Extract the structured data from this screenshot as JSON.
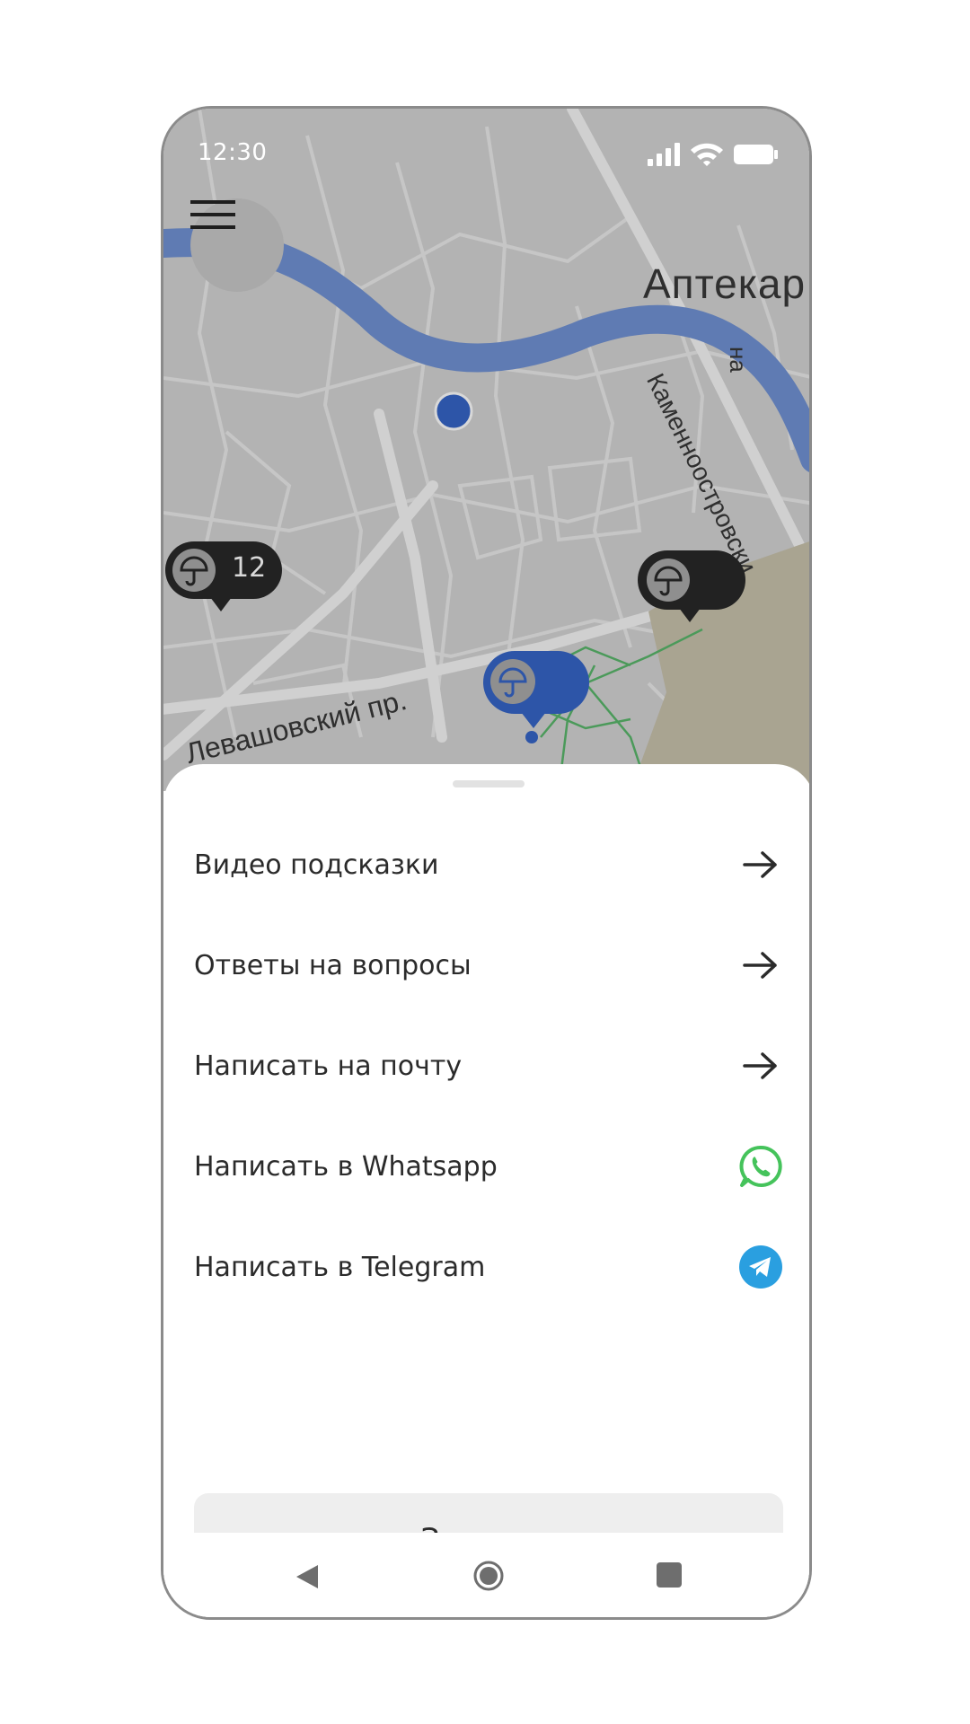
{
  "status_bar": {
    "time": "12:30"
  },
  "map": {
    "labels": {
      "district": "Аптекар",
      "district_suffix": "на",
      "street_prospekt": "Левашовский пр.",
      "street_kamenno": "Каменноостровски"
    },
    "pins": [
      {
        "kind": "umbrella",
        "count": "12",
        "style": "dark"
      },
      {
        "kind": "umbrella",
        "count": "",
        "style": "dark"
      },
      {
        "kind": "umbrella",
        "count": "",
        "style": "blue"
      }
    ],
    "colors": {
      "river": "#5f7bb3",
      "blue_pin": "#2d55a8",
      "dark_pin": "#222222",
      "park": "#a9a491"
    }
  },
  "sheet": {
    "items": [
      {
        "label": "Видео подсказки",
        "icon": "arrow-right-icon"
      },
      {
        "label": "Ответы на вопросы",
        "icon": "arrow-right-icon"
      },
      {
        "label": "Написать на почту",
        "icon": "arrow-right-icon"
      },
      {
        "label": "Написать в Whatsapp",
        "icon": "whatsapp-icon"
      },
      {
        "label": "Написать в Telegram",
        "icon": "telegram-icon"
      }
    ],
    "close_label": "Закрыть",
    "colors": {
      "whatsapp": "#45c35b",
      "telegram": "#2a9fe0"
    }
  },
  "nav_bar": {
    "buttons": [
      "back-icon",
      "home-icon",
      "recents-icon"
    ]
  }
}
